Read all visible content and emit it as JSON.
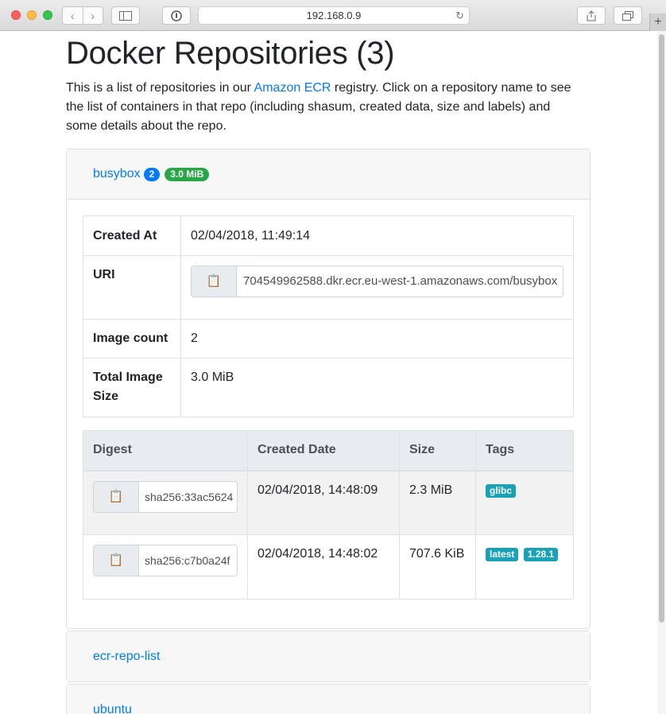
{
  "browser": {
    "url": "192.168.0.9",
    "icons": {
      "back": "chevron-left-icon",
      "forward": "chevron-right-icon",
      "sidebar": "sidebar-icon",
      "password": "password-key-icon",
      "reload": "reload-icon",
      "share": "share-icon",
      "tabs": "tabs-icon",
      "new_tab": "plus-icon"
    }
  },
  "page": {
    "title": "Docker Repositories (3)",
    "intro_before": "This is a list of repositories in our ",
    "intro_link": "Amazon ECR",
    "intro_after": " registry. Click on a repository name to see the list of containers in that repo (including shasum, created data, size and labels) and some details about the repo."
  },
  "repos": [
    {
      "name": "busybox",
      "count_badge": "2",
      "size_badge": "3.0 MiB",
      "details": {
        "created_label": "Created At",
        "created_value": "02/04/2018, 11:49:14",
        "uri_label": "URI",
        "uri_value": "704549962588.dkr.ecr.eu-west-1.amazonaws.com/busybox",
        "count_label": "Image count",
        "count_value": "2",
        "size_label": "Total Image Size",
        "size_value": "3.0 MiB"
      },
      "images_headers": [
        "Digest",
        "Created Date",
        "Size",
        "Tags"
      ],
      "images": [
        {
          "digest": "sha256:33ac5624",
          "created": "02/04/2018, 14:48:09",
          "size": "2.3 MiB",
          "tags": [
            "glibc"
          ]
        },
        {
          "digest": "sha256:c7b0a24f",
          "created": "02/04/2018, 14:48:02",
          "size": "707.6 KiB",
          "tags": [
            "latest",
            "1.28.1"
          ]
        }
      ]
    },
    {
      "name": "ecr-repo-list"
    },
    {
      "name": "ubuntu"
    }
  ],
  "colors": {
    "link": "#007bff",
    "badge_count": "#007bff",
    "badge_size": "#28a745",
    "tag": "#17a2b8"
  }
}
